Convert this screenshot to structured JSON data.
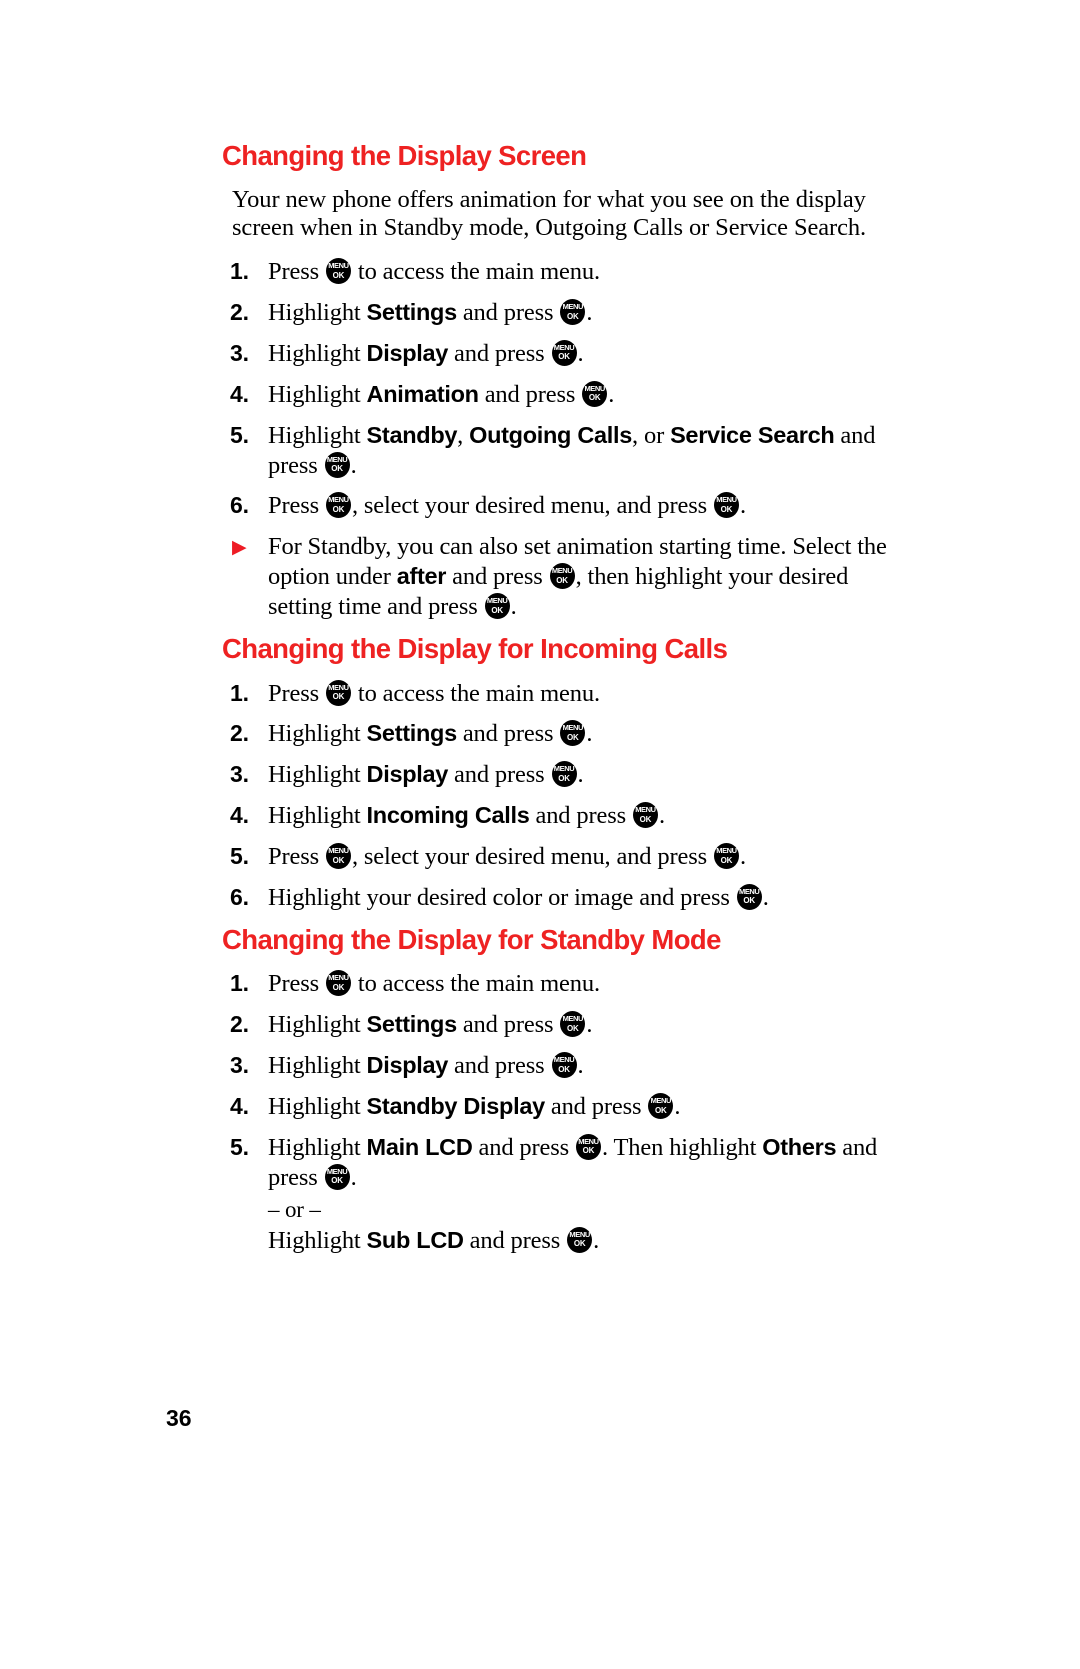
{
  "colors": {
    "heading_red": "#ee2222",
    "bullet_red": "#ee1c25",
    "text": "#000000",
    "background": "#ffffff"
  },
  "key_icon": {
    "name": "menu-ok-key-icon",
    "line1": "MENU",
    "line2": "OK"
  },
  "sections": [
    {
      "heading": "Changing the Display Screen",
      "intro": "Your new phone offers animation for what you see on the display screen when in Standby mode, Outgoing Calls or Service Search.",
      "steps": [
        {
          "marker": "1.",
          "parts": [
            {
              "t": "text",
              "v": "Press "
            },
            {
              "t": "key"
            },
            {
              "t": "text",
              "v": " to access the main menu."
            }
          ]
        },
        {
          "marker": "2.",
          "parts": [
            {
              "t": "text",
              "v": "Highlight "
            },
            {
              "t": "bold",
              "v": "Settings"
            },
            {
              "t": "text",
              "v": " and press "
            },
            {
              "t": "key"
            },
            {
              "t": "text",
              "v": "."
            }
          ]
        },
        {
          "marker": "3.",
          "parts": [
            {
              "t": "text",
              "v": "Highlight "
            },
            {
              "t": "bold",
              "v": "Display"
            },
            {
              "t": "text",
              "v": " and press "
            },
            {
              "t": "key"
            },
            {
              "t": "text",
              "v": "."
            }
          ]
        },
        {
          "marker": "4.",
          "parts": [
            {
              "t": "text",
              "v": "Highlight "
            },
            {
              "t": "bold",
              "v": "Animation"
            },
            {
              "t": "text",
              "v": " and press "
            },
            {
              "t": "key"
            },
            {
              "t": "text",
              "v": "."
            }
          ]
        },
        {
          "marker": "5.",
          "parts": [
            {
              "t": "text",
              "v": "Highlight "
            },
            {
              "t": "bold",
              "v": "Standby"
            },
            {
              "t": "text",
              "v": ", "
            },
            {
              "t": "bold",
              "v": "Outgoing Calls"
            },
            {
              "t": "text",
              "v": ", or "
            },
            {
              "t": "bold",
              "v": "Service Search"
            },
            {
              "t": "text",
              "v": " and press "
            },
            {
              "t": "key"
            },
            {
              "t": "text",
              "v": "."
            }
          ]
        },
        {
          "marker": "6.",
          "parts": [
            {
              "t": "text",
              "v": "Press "
            },
            {
              "t": "key"
            },
            {
              "t": "text",
              "v": ", select your desired menu, and press "
            },
            {
              "t": "key"
            },
            {
              "t": "text",
              "v": "."
            }
          ]
        },
        {
          "marker": "▶",
          "marker_kind": "arrow",
          "parts": [
            {
              "t": "text",
              "v": "For Standby, you can also set animation starting time. Select the option under "
            },
            {
              "t": "bold",
              "v": "after"
            },
            {
              "t": "text",
              "v": " and press "
            },
            {
              "t": "key"
            },
            {
              "t": "text",
              "v": ", then highlight your desired setting time and press "
            },
            {
              "t": "key"
            },
            {
              "t": "text",
              "v": "."
            }
          ]
        }
      ]
    },
    {
      "heading": "Changing the Display for Incoming Calls",
      "intro": "",
      "steps": [
        {
          "marker": "1.",
          "parts": [
            {
              "t": "text",
              "v": "Press "
            },
            {
              "t": "key"
            },
            {
              "t": "text",
              "v": " to access the main menu."
            }
          ]
        },
        {
          "marker": "2.",
          "parts": [
            {
              "t": "text",
              "v": "Highlight "
            },
            {
              "t": "bold",
              "v": "Settings"
            },
            {
              "t": "text",
              "v": " and press "
            },
            {
              "t": "key"
            },
            {
              "t": "text",
              "v": "."
            }
          ]
        },
        {
          "marker": "3.",
          "parts": [
            {
              "t": "text",
              "v": "Highlight "
            },
            {
              "t": "bold",
              "v": "Display"
            },
            {
              "t": "text",
              "v": " and press "
            },
            {
              "t": "key"
            },
            {
              "t": "text",
              "v": "."
            }
          ]
        },
        {
          "marker": "4.",
          "parts": [
            {
              "t": "text",
              "v": "Highlight "
            },
            {
              "t": "bold",
              "v": "Incoming Calls"
            },
            {
              "t": "text",
              "v": " and press "
            },
            {
              "t": "key"
            },
            {
              "t": "text",
              "v": "."
            }
          ]
        },
        {
          "marker": "5.",
          "parts": [
            {
              "t": "text",
              "v": "Press "
            },
            {
              "t": "key"
            },
            {
              "t": "text",
              "v": ", select your desired menu, and press "
            },
            {
              "t": "key"
            },
            {
              "t": "text",
              "v": "."
            }
          ]
        },
        {
          "marker": "6.",
          "parts": [
            {
              "t": "text",
              "v": "Highlight your desired color or image and press "
            },
            {
              "t": "key"
            },
            {
              "t": "text",
              "v": "."
            }
          ]
        }
      ]
    },
    {
      "heading": "Changing the Display for Standby Mode",
      "intro": "",
      "steps": [
        {
          "marker": "1.",
          "parts": [
            {
              "t": "text",
              "v": "Press "
            },
            {
              "t": "key"
            },
            {
              "t": "text",
              "v": " to access the main menu."
            }
          ]
        },
        {
          "marker": "2.",
          "parts": [
            {
              "t": "text",
              "v": "Highlight "
            },
            {
              "t": "bold",
              "v": "Settings"
            },
            {
              "t": "text",
              "v": " and press "
            },
            {
              "t": "key"
            },
            {
              "t": "text",
              "v": "."
            }
          ]
        },
        {
          "marker": "3.",
          "parts": [
            {
              "t": "text",
              "v": "Highlight "
            },
            {
              "t": "bold",
              "v": "Display"
            },
            {
              "t": "text",
              "v": " and press "
            },
            {
              "t": "key"
            },
            {
              "t": "text",
              "v": "."
            }
          ]
        },
        {
          "marker": "4.",
          "parts": [
            {
              "t": "text",
              "v": "Highlight "
            },
            {
              "t": "bold",
              "v": "Standby Display"
            },
            {
              "t": "text",
              "v": " and press "
            },
            {
              "t": "key"
            },
            {
              "t": "text",
              "v": "."
            }
          ]
        },
        {
          "marker": "5.",
          "parts": [
            {
              "t": "text",
              "v": "Highlight "
            },
            {
              "t": "bold",
              "v": "Main LCD"
            },
            {
              "t": "text",
              "v": " and press "
            },
            {
              "t": "key"
            },
            {
              "t": "text",
              "v": ". Then highlight "
            },
            {
              "t": "bold",
              "v": "Others"
            },
            {
              "t": "text",
              "v": " and press "
            },
            {
              "t": "key"
            },
            {
              "t": "text",
              "v": "."
            }
          ],
          "extra_lines": [
            {
              "kind": "or",
              "parts": [
                {
                  "t": "text",
                  "v": "– or –"
                }
              ]
            },
            {
              "kind": "alt",
              "parts": [
                {
                  "t": "text",
                  "v": "Highlight "
                },
                {
                  "t": "bold",
                  "v": "Sub LCD"
                },
                {
                  "t": "text",
                  "v": " and press "
                },
                {
                  "t": "key"
                },
                {
                  "t": "text",
                  "v": "."
                }
              ]
            }
          ]
        }
      ]
    }
  ],
  "footer": {
    "page_number": "36"
  }
}
